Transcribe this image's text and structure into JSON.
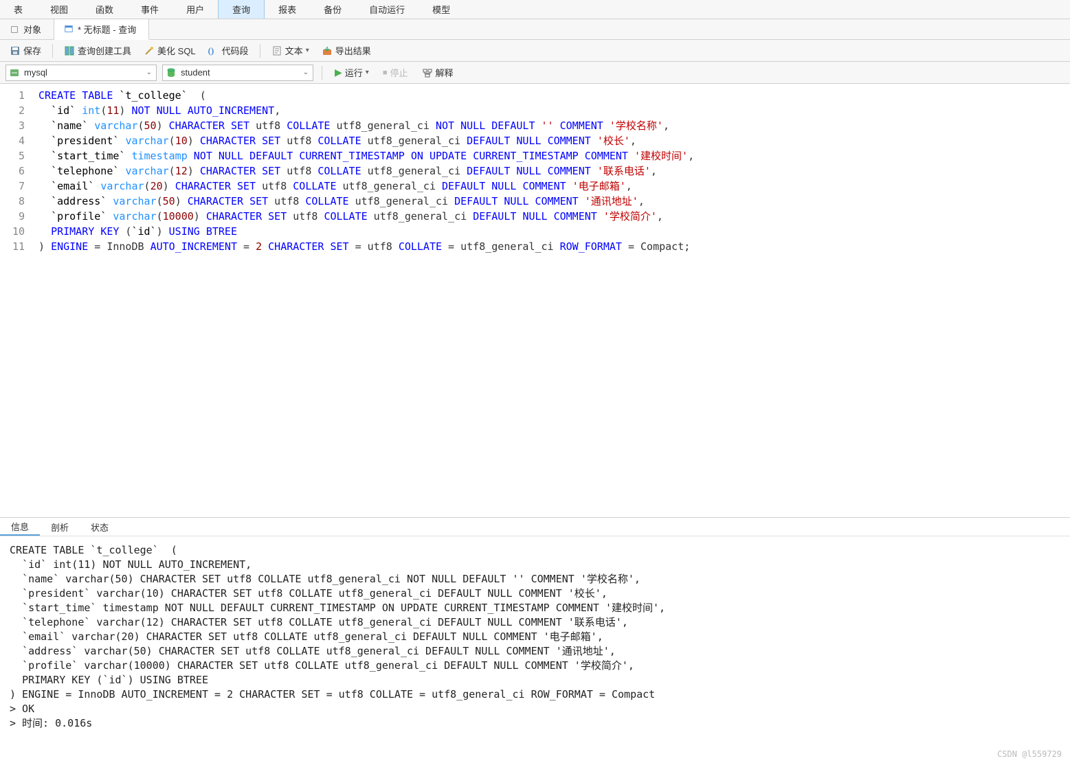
{
  "menu": {
    "items": [
      "表",
      "视图",
      "函数",
      "事件",
      "用户",
      "查询",
      "报表",
      "备份",
      "自动运行",
      "模型"
    ],
    "active_index": 5
  },
  "tabs": {
    "items": [
      {
        "label": "对象",
        "icon": "object-icon"
      },
      {
        "label": "* 无标题 - 查询",
        "icon": "query-icon"
      }
    ],
    "active_index": 1
  },
  "toolbar": {
    "save": "保存",
    "query_builder": "查询创建工具",
    "beautify": "美化 SQL",
    "snippet": "代码段",
    "text": "文本",
    "export": "导出结果"
  },
  "conn": {
    "connection": "mysql",
    "database": "student",
    "run": "运行",
    "stop": "停止",
    "explain": "解释"
  },
  "code": {
    "lines": [
      "CREATE TABLE `t_college`  (",
      "  `id` int(11) NOT NULL AUTO_INCREMENT,",
      "  `name` varchar(50) CHARACTER SET utf8 COLLATE utf8_general_ci NOT NULL DEFAULT '' COMMENT '学校名称',",
      "  `president` varchar(10) CHARACTER SET utf8 COLLATE utf8_general_ci DEFAULT NULL COMMENT '校长',",
      "  `start_time` timestamp NOT NULL DEFAULT CURRENT_TIMESTAMP ON UPDATE CURRENT_TIMESTAMP COMMENT '建校时间',",
      "  `telephone` varchar(12) CHARACTER SET utf8 COLLATE utf8_general_ci DEFAULT NULL COMMENT '联系电话',",
      "  `email` varchar(20) CHARACTER SET utf8 COLLATE utf8_general_ci DEFAULT NULL COMMENT '电子邮箱',",
      "  `address` varchar(50) CHARACTER SET utf8 COLLATE utf8_general_ci DEFAULT NULL COMMENT '通讯地址',",
      "  `profile` varchar(10000) CHARACTER SET utf8 COLLATE utf8_general_ci DEFAULT NULL COMMENT '学校简介',",
      "  PRIMARY KEY (`id`) USING BTREE",
      ") ENGINE = InnoDB AUTO_INCREMENT = 2 CHARACTER SET = utf8 COLLATE = utf8_general_ci ROW_FORMAT = Compact;"
    ]
  },
  "output": {
    "tabs": [
      "信息",
      "剖析",
      "状态"
    ],
    "active_index": 0,
    "text": "CREATE TABLE `t_college`  (\n  `id` int(11) NOT NULL AUTO_INCREMENT,\n  `name` varchar(50) CHARACTER SET utf8 COLLATE utf8_general_ci NOT NULL DEFAULT '' COMMENT '学校名称',\n  `president` varchar(10) CHARACTER SET utf8 COLLATE utf8_general_ci DEFAULT NULL COMMENT '校长',\n  `start_time` timestamp NOT NULL DEFAULT CURRENT_TIMESTAMP ON UPDATE CURRENT_TIMESTAMP COMMENT '建校时间',\n  `telephone` varchar(12) CHARACTER SET utf8 COLLATE utf8_general_ci DEFAULT NULL COMMENT '联系电话',\n  `email` varchar(20) CHARACTER SET utf8 COLLATE utf8_general_ci DEFAULT NULL COMMENT '电子邮箱',\n  `address` varchar(50) CHARACTER SET utf8 COLLATE utf8_general_ci DEFAULT NULL COMMENT '通讯地址',\n  `profile` varchar(10000) CHARACTER SET utf8 COLLATE utf8_general_ci DEFAULT NULL COMMENT '学校简介',\n  PRIMARY KEY (`id`) USING BTREE\n) ENGINE = InnoDB AUTO_INCREMENT = 2 CHARACTER SET = utf8 COLLATE = utf8_general_ci ROW_FORMAT = Compact\n> OK\n> 时间: 0.016s"
  },
  "watermark": "CSDN @l559729"
}
